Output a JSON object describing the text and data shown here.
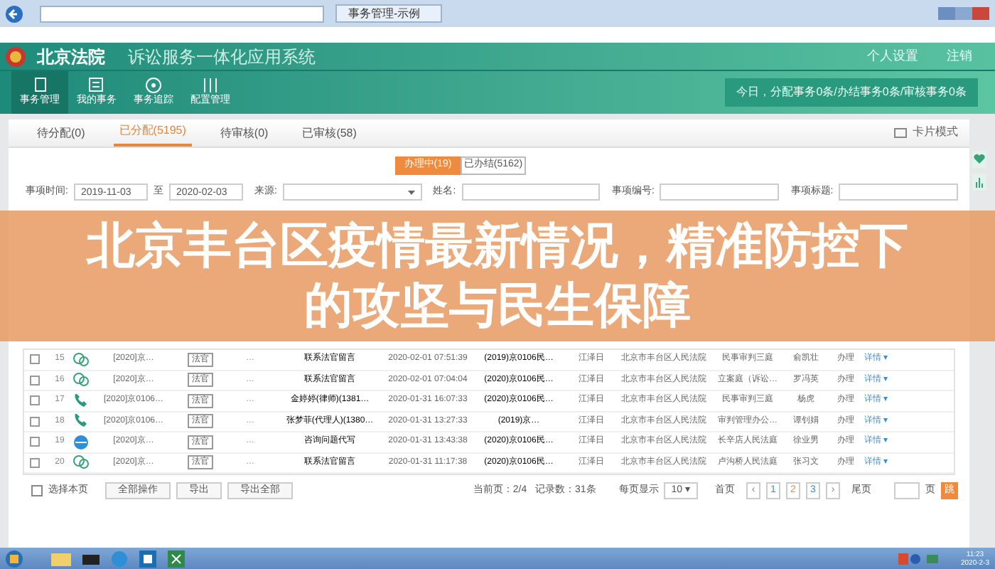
{
  "browser": {
    "tab_title": "事务管理-示例"
  },
  "header": {
    "logo": "北京法院",
    "system": "诉讼服务一体化应用系统",
    "links": [
      "个人设置",
      "注销"
    ]
  },
  "nav": [
    {
      "label": "事务管理",
      "selected": true
    },
    {
      "label": "我的事务",
      "selected": false
    },
    {
      "label": "事务追踪",
      "selected": false
    },
    {
      "label": "配置管理",
      "selected": false
    }
  ],
  "notice": "今日，分配事务0条/办结事务0条/审核事务0条",
  "tabs": [
    {
      "label": "待分配(0)",
      "selected": false
    },
    {
      "label": "已分配(5195)",
      "selected": true
    },
    {
      "label": "待审核(0)",
      "selected": false
    },
    {
      "label": "已审核(58)",
      "selected": false
    }
  ],
  "view_mode": "卡片模式",
  "toggle": [
    {
      "label": "办理中(19)",
      "selected": true
    },
    {
      "label": "已办结(5162)",
      "selected": false
    }
  ],
  "filters": [
    {
      "label": "事项时间:",
      "kind": "daterange",
      "from": "2019-11-03",
      "sep": "至",
      "to": "2020-02-03"
    },
    {
      "label": "来源:",
      "kind": "select"
    },
    {
      "label": "姓名:",
      "kind": "text"
    },
    {
      "label": "事项编号:",
      "kind": "text"
    },
    {
      "label": "事项标题:",
      "kind": "text"
    }
  ],
  "headline": "北京丰台区疫情最新情况，精准防控下的攻坚与民生保障",
  "rows": [
    {
      "no": "15",
      "checked": false,
      "kind": "wechat",
      "case": "[2020]京…",
      "tag": "法官",
      "name": "…",
      "title": "联系法官留言",
      "time": "2020-02-01 07:51:39",
      "case_no": "(2019)京0106民…",
      "handler": "江泽日",
      "court": "北京市丰台区人民法院",
      "dept": "民事审判三庭",
      "judge": "俞凯壮",
      "status": "办理",
      "action": "详情 ▾"
    },
    {
      "no": "16",
      "checked": false,
      "kind": "wechat",
      "case": "[2020]京…",
      "tag": "法官",
      "name": "…",
      "title": "联系法官留言",
      "time": "2020-02-01 07:04:04",
      "case_no": "(2020)京0106民…",
      "handler": "江泽日",
      "court": "北京市丰台区人民法院",
      "dept": "立案庭（诉讼…",
      "judge": "罗冯英",
      "status": "办理",
      "action": "详情 ▾"
    },
    {
      "no": "17",
      "checked": false,
      "kind": "phone",
      "case": "[2020]京0106…",
      "tag": "法官",
      "name": "…",
      "title": "金婷婷(律师)(1381…",
      "time": "2020-01-31 16:07:33",
      "case_no": "(2020)京0106民…",
      "handler": "江泽日",
      "court": "北京市丰台区人民法院",
      "dept": "民事审判三庭",
      "judge": "杨虎",
      "status": "办理",
      "action": "详情 ▾"
    },
    {
      "no": "18",
      "checked": false,
      "kind": "phone",
      "case": "[2020]京0106…",
      "tag": "法官",
      "name": "…",
      "title": "张梦菲(代理人)(1380…",
      "time": "2020-01-31 13:27:33",
      "case_no": "(2019)京…",
      "handler": "江泽日",
      "court": "北京市丰台区人民法院",
      "dept": "审判管理办公…",
      "judge": "谭钊娟",
      "status": "办理",
      "action": "详情 ▾"
    },
    {
      "no": "19",
      "checked": false,
      "kind": "web",
      "case": "[2020]京…",
      "tag": "法官",
      "name": "…",
      "title": "咨询问题代写",
      "time": "2020-01-31 13:43:38",
      "case_no": "(2020)京0106民…",
      "handler": "江泽日",
      "court": "北京市丰台区人民法院",
      "dept": "长辛店人民法庭",
      "judge": "徐业男",
      "status": "办理",
      "action": "详情 ▾"
    },
    {
      "no": "20",
      "checked": false,
      "kind": "wechat",
      "case": "[2020]京…",
      "tag": "法官",
      "name": "…",
      "title": "联系法官留言",
      "time": "2020-01-31 11:17:38",
      "case_no": "(2020)京0106民…",
      "handler": "江泽日",
      "court": "北京市丰台区人民法院",
      "dept": "卢沟桥人民法庭",
      "judge": "张习文",
      "status": "办理",
      "action": "详情 ▾"
    }
  ],
  "footer": {
    "select_page": "选择本页",
    "select_page_checked": false,
    "buttons": [
      "全部操作",
      "导出",
      "导出全部"
    ]
  },
  "pager": {
    "info": "当前页：2/4   记录数：31条",
    "per_page_label": "每页显示",
    "per_page": "10 ▾",
    "first": "首页",
    "prev": "‹",
    "pages": [
      {
        "label": "1",
        "selected": false
      },
      {
        "label": "2",
        "selected": true
      },
      {
        "label": "3",
        "selected": false
      }
    ],
    "next": "›",
    "last": "尾页",
    "page_unit": "页",
    "go": "跳"
  },
  "clock": {
    "time": "11:23",
    "date": "2020-2-3"
  }
}
